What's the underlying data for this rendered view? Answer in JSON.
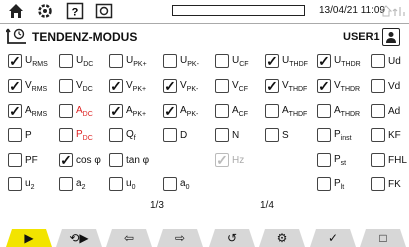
{
  "topbar": {
    "icons": [
      "home-icon",
      "settings-icon",
      "help-icon",
      "camera-icon"
    ],
    "datetime": "13/04/21 11:09",
    "status_icons": "⌂ ⌂↑"
  },
  "header": {
    "title": "TENDENZ-MODUS",
    "user": "USER1"
  },
  "grid": {
    "rows": [
      [
        {
          "l": "U",
          "s": "RMS",
          "c": true
        },
        {
          "l": "U",
          "s": "DC",
          "c": false
        },
        {
          "l": "U",
          "s": "PK+",
          "c": false
        },
        {
          "l": "U",
          "s": "PK-",
          "c": false
        },
        {
          "l": "U",
          "s": "CF",
          "c": false
        },
        {
          "l": "U",
          "s": "THDF",
          "c": true
        },
        {
          "l": "U",
          "s": "THDR",
          "c": true
        },
        {
          "l": "Ud",
          "s": "",
          "c": false
        }
      ],
      [
        {
          "l": "V",
          "s": "RMS",
          "c": true
        },
        {
          "l": "V",
          "s": "DC",
          "c": false
        },
        {
          "l": "V",
          "s": "PK+",
          "c": true
        },
        {
          "l": "V",
          "s": "PK-",
          "c": true
        },
        {
          "l": "V",
          "s": "CF",
          "c": false
        },
        {
          "l": "V",
          "s": "THDF",
          "c": true
        },
        {
          "l": "V",
          "s": "THDR",
          "c": true
        },
        {
          "l": "Vd",
          "s": "",
          "c": false
        }
      ],
      [
        {
          "l": "A",
          "s": "RMS",
          "c": true
        },
        {
          "l": "A",
          "s": "DC",
          "c": false,
          "red": true
        },
        {
          "l": "A",
          "s": "PK+",
          "c": true
        },
        {
          "l": "A",
          "s": "PK-",
          "c": true
        },
        {
          "l": "A",
          "s": "CF",
          "c": false
        },
        {
          "l": "A",
          "s": "THDF",
          "c": false
        },
        {
          "l": "A",
          "s": "THDR",
          "c": false
        },
        {
          "l": "Ad",
          "s": "",
          "c": false
        }
      ],
      [
        {
          "l": "P",
          "s": "",
          "c": false
        },
        {
          "l": "P",
          "s": "DC",
          "c": false,
          "red": true
        },
        {
          "l": "Q",
          "s": "f",
          "c": false
        },
        {
          "l": "D",
          "s": "",
          "c": false
        },
        {
          "l": "N",
          "s": "",
          "c": false
        },
        {
          "l": "S",
          "s": "",
          "c": false
        },
        {
          "l": "P",
          "s": "inst",
          "c": false
        },
        {
          "l": "KF",
          "s": "",
          "c": false
        }
      ],
      [
        {
          "l": "PF",
          "s": "",
          "c": false
        },
        {
          "l": "cos φ",
          "s": "",
          "c": true
        },
        {
          "l": "tan φ",
          "s": "",
          "c": false
        },
        null,
        {
          "l": "Hz",
          "s": "",
          "c": true,
          "disabled": true
        },
        null,
        {
          "l": "P",
          "s": "st",
          "c": false
        },
        {
          "l": "FHL",
          "s": "",
          "c": false
        }
      ],
      [
        {
          "l": "u",
          "s": "2",
          "c": false
        },
        {
          "l": "a",
          "s": "2",
          "c": false
        },
        {
          "l": "u",
          "s": "0",
          "c": false
        },
        {
          "l": "a",
          "s": "0",
          "c": false
        },
        null,
        null,
        {
          "l": "P",
          "s": "lt",
          "c": false
        },
        {
          "l": "FK",
          "s": "",
          "c": false
        }
      ]
    ]
  },
  "pagination": {
    "left": "1/3",
    "right": "1/4"
  },
  "bottombar": {
    "buttons": [
      {
        "name": "play-button",
        "glyph": "▶",
        "active": true
      },
      {
        "name": "trend-play-button",
        "glyph": "⟲▶",
        "active": false
      },
      {
        "name": "export-button",
        "glyph": "⇦",
        "active": false
      },
      {
        "name": "import-button",
        "glyph": "⇨",
        "active": false
      },
      {
        "name": "trend-list-button",
        "glyph": "↺",
        "active": false
      },
      {
        "name": "trend-config-button",
        "glyph": "⚙",
        "active": false
      },
      {
        "name": "confirm-button",
        "glyph": "✓",
        "active": false
      },
      {
        "name": "stop-button",
        "glyph": "□",
        "active": false
      }
    ]
  }
}
